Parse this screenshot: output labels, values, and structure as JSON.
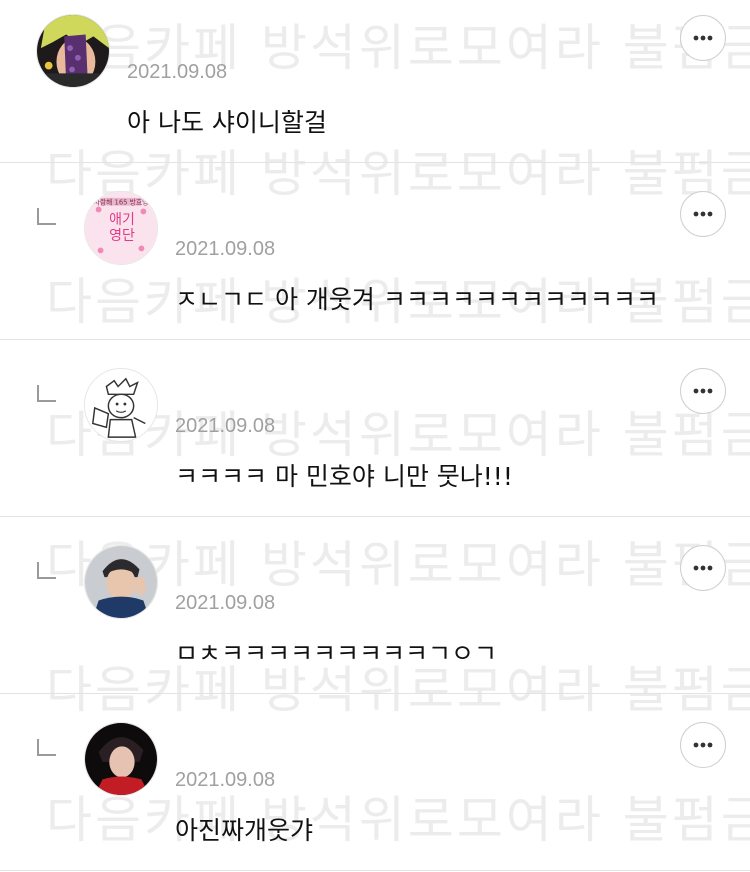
{
  "watermark": "다음카페 방석위로모여라 불펌금지",
  "comments": [
    {
      "type": "comment",
      "date": "2021.09.08",
      "text": "아 나도 샤이니할걸"
    },
    {
      "type": "reply",
      "date": "2021.09.08",
      "text": "ㅈㄴㄱㄷ 아 개웃겨 ㅋㅋㅋㅋㅋㅋㅋㅋㅋㅋㅋㅋ",
      "avatar_text": "애기 영단"
    },
    {
      "type": "reply",
      "date": "2021.09.08",
      "text": "ㅋㅋㅋㅋ 마 민호야 니만 뭇나!!!"
    },
    {
      "type": "reply",
      "date": "2021.09.08",
      "text": "ㅁㅊㅋㅋㅋㅋㅋㅋㅋㅋㅋㄱㅇㄱ"
    },
    {
      "type": "reply",
      "date": "2021.09.08",
      "text": "아진짜개웃갸"
    }
  ],
  "icons": {
    "more": "more-horizontal-icon",
    "reply": "reply-arrow-icon"
  }
}
